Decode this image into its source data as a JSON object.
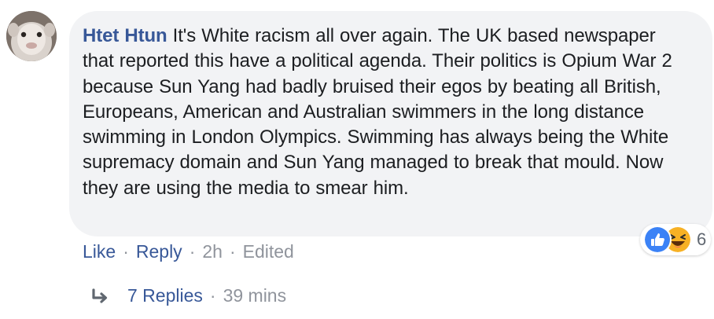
{
  "comment": {
    "author": "Htet Htun",
    "text": " It's White racism all over again. The UK based newspaper that reported this have a political agenda. Their politics is Opium War 2 because Sun Yang had badly bruised their egos by beating all British, Europeans, American and Australian swimmers in the long distance swimming in London Olympics. Swimming has always being the White supremacy domain and Sun Yang managed to break that mould. Now they are using the media to smear him.",
    "avatar_icon": "avatar-photo"
  },
  "reactions": {
    "icons": [
      "like-icon",
      "haha-icon"
    ],
    "count": "6"
  },
  "actions": {
    "like_label": "Like",
    "reply_label": "Reply",
    "separator": "·",
    "time": "2h",
    "edited_label": "Edited"
  },
  "replies": {
    "label": "7 Replies",
    "time": "39 mins",
    "icon": "reply-arrow-icon"
  },
  "colors": {
    "link": "#385898",
    "text": "#1c1e21",
    "meta": "#90949c",
    "bubble": "#f2f3f5"
  }
}
